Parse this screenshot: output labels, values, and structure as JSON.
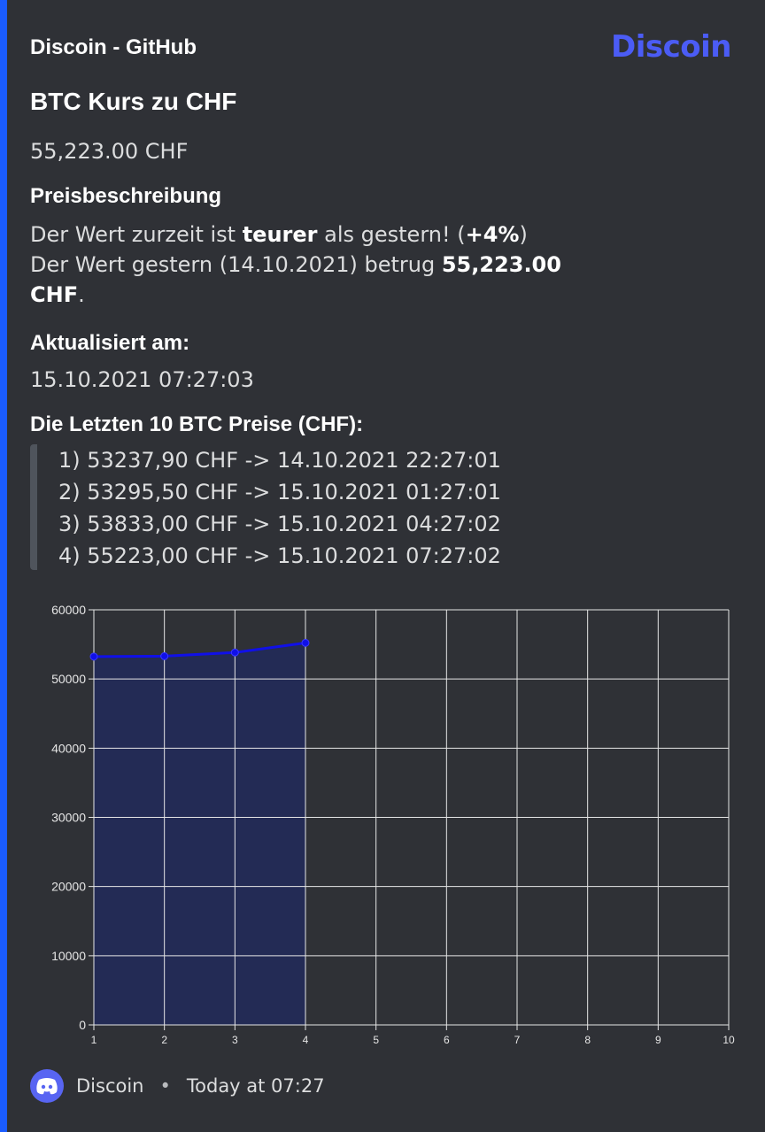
{
  "embed": {
    "accent_color": "#1a5cff",
    "author": "Discoin - GitHub",
    "logo_text": "Discoin",
    "title": "BTC Kurs zu CHF",
    "description": "55,223.00 CHF"
  },
  "fields": {
    "price_desc": {
      "name": "Preisbeschreibung",
      "line1_pre": "Der Wert zurzeit ist ",
      "line1_bold": "teurer",
      "line1_mid": " als gestern! (",
      "line1_pct": "+4%",
      "line1_post": ")",
      "line2_pre": "Der Wert gestern (14.10.2021) betrug ",
      "line2_bold": "55,223.00",
      "line3_bold": "CHF",
      "line3_post": "."
    },
    "updated": {
      "name": "Aktualisiert am:",
      "value": "15.10.2021 07:27:03"
    },
    "last_prices": {
      "name": "Die Letzten 10 BTC Preise (CHF):",
      "items": [
        "1) 53237,90 CHF -> 14.10.2021 22:27:01",
        "2) 53295,50 CHF -> 15.10.2021 01:27:01",
        "3) 53833,00 CHF -> 15.10.2021 04:27:02",
        "4) 55223,00 CHF -> 15.10.2021 07:27:02"
      ]
    }
  },
  "footer": {
    "bot_name": "Discoin",
    "separator": "•",
    "timestamp": "Today at 07:27",
    "avatar_icon": "discord-logo-icon"
  },
  "chart_data": {
    "type": "line",
    "x": [
      1,
      2,
      3,
      4
    ],
    "values": [
      53237.9,
      53295.5,
      53833.0,
      55223.0
    ],
    "xlim": [
      1,
      10
    ],
    "ylim": [
      0,
      60000
    ],
    "xticks": [
      1,
      2,
      3,
      4,
      5,
      6,
      7,
      8,
      9,
      10
    ],
    "yticks": [
      0,
      10000,
      20000,
      30000,
      40000,
      50000,
      60000
    ],
    "grid": true,
    "filled_area": true,
    "line_color": "#1010e8",
    "fill_color": "#232b55",
    "grid_color": "#e6e6e6",
    "tick_color": "#e6e6e6"
  }
}
